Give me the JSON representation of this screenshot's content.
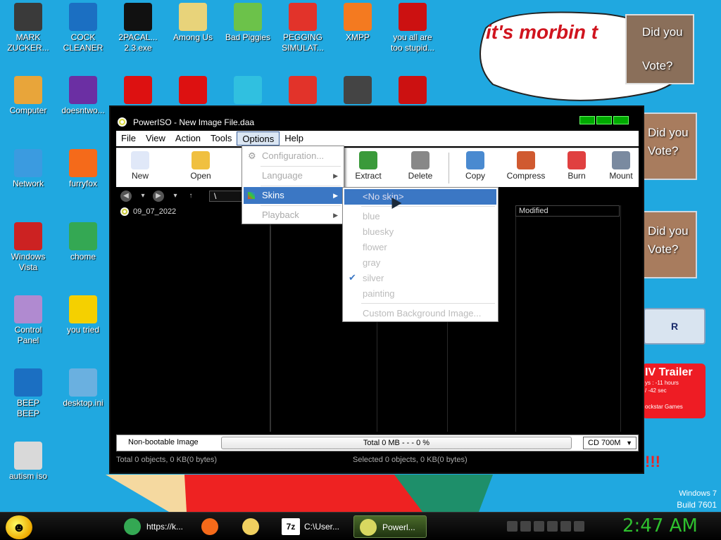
{
  "desktop": {
    "icons": [
      {
        "label": "MARK\nZUCKER...",
        "icon": "person-icon",
        "color": "#3a3a3a"
      },
      {
        "label": "COCK\nCLEANER",
        "icon": "book-icon",
        "color": "#1b6fc2"
      },
      {
        "label": "2PACAL...\n2.3.exe",
        "icon": "terminal-icon",
        "color": "#111111"
      },
      {
        "label": "Among Us",
        "icon": "drive-icon",
        "color": "#e8d37a"
      },
      {
        "label": "Bad Piggies",
        "icon": "pig-icon",
        "color": "#6cc24a"
      },
      {
        "label": "PEGGING\nSIMULAT...",
        "icon": "p-logo-icon",
        "color": "#e2332a"
      },
      {
        "label": "XMPP",
        "icon": "xampp-icon",
        "color": "#f47a20"
      },
      {
        "label": "you all are\ntoo stupid...",
        "icon": "dev-cpp-icon",
        "color": "#cc1111"
      },
      {
        "label": "Computer",
        "icon": "computer-icon",
        "color": "#e8a53a"
      },
      {
        "label": "doesntwo...",
        "icon": "yahoo-icon",
        "color": "#6b2fa3"
      },
      {
        "label": "",
        "icon": "angry-bird-icon",
        "color": "#d11"
      },
      {
        "label": "",
        "icon": "angry-bird-icon",
        "color": "#d11"
      },
      {
        "label": "",
        "icon": "gem-icon",
        "color": "#30c0e0"
      },
      {
        "label": "",
        "icon": "p-logo-icon",
        "color": "#e2332a"
      },
      {
        "label": "",
        "icon": "sd-icon",
        "color": "#444444"
      },
      {
        "label": "",
        "icon": "radiation-icon",
        "color": "#cc1111"
      },
      {
        "label": "Network",
        "icon": "globe-icon",
        "color": "#3b9be0"
      },
      {
        "label": "furryfox",
        "icon": "firefox-icon",
        "color": "#f56a1a"
      },
      {
        "label": "Windows\nVista",
        "icon": "recycle-bin-icon",
        "color": "#cc2222"
      },
      {
        "label": "chome",
        "icon": "chrome-icon",
        "color": "#34a853"
      },
      {
        "label": "Control\nPanel",
        "icon": "control-panel-icon",
        "color": "#b08ad0"
      },
      {
        "label": "you tried",
        "icon": "star-icon",
        "color": "#f5d000"
      },
      {
        "label": "BEEP\nBEEP",
        "icon": "book-icon",
        "color": "#1b6fc2"
      },
      {
        "label": "desktop.ini",
        "icon": "settings-file-icon",
        "color": "#6ab0e0"
      },
      {
        "label": "autism iso",
        "icon": "disc-icon",
        "color": "#d9d9d9"
      }
    ],
    "speech_text": "it's morbin t",
    "vote_cards": [
      {
        "text": "Did you\nVote?"
      },
      {
        "text": "Did you\nVote?"
      },
      {
        "text": "Did you\nVote?"
      }
    ],
    "president_text": "R PRESIDENT",
    "gta_title": "IV Trailer",
    "gta_line1": "ys : -11 hours",
    "gta_line2": "/ -42 sec",
    "gta_line3": "ockstar Games",
    "exclaim": "!!!",
    "windows_brand": "Windows 7",
    "build": "Build 7601"
  },
  "app": {
    "title": "PowerISO - New Image File.daa",
    "menu": [
      "File",
      "View",
      "Action",
      "Tools",
      "Options",
      "Help"
    ],
    "toolbar": [
      {
        "label": "New",
        "icon": "new-icon",
        "color": "#e0e8f8"
      },
      {
        "label": "Open",
        "icon": "open-folder-icon",
        "color": "#f0c040"
      },
      {
        "label": "Extract",
        "icon": "extract-icon",
        "color": "#3a9a3a"
      },
      {
        "label": "Delete",
        "icon": "delete-icon",
        "color": "#888888"
      },
      {
        "label": "Copy",
        "icon": "copy-icon",
        "color": "#4a8ad0"
      },
      {
        "label": "Compress",
        "icon": "compress-icon",
        "color": "#d05a30"
      },
      {
        "label": "Burn",
        "icon": "burn-icon",
        "color": "#e04040"
      },
      {
        "label": "Mount",
        "icon": "mount-icon",
        "color": "#7a8aa0"
      }
    ],
    "address": "\\",
    "tree_item": "09_07_2022",
    "list_header_modified": "Modified",
    "boot_status": "Non-bootable Image",
    "progress_text": "Total  0 MB   - - -  0 %",
    "progress_percent": 0,
    "capacity": "CD 700M",
    "status_total": "Total 0 objects, 0 KB(0 bytes)",
    "status_selected": "Selected 0 objects, 0 KB(0 bytes)"
  },
  "options_menu": {
    "items": [
      {
        "label": "Configuration...",
        "has_sub": false
      },
      {
        "label": "Language",
        "has_sub": true
      },
      {
        "label": "Skins",
        "has_sub": true
      },
      {
        "label": "Playback",
        "has_sub": true
      }
    ]
  },
  "skins_menu": {
    "items": [
      "<No skin>",
      "blue",
      "bluesky",
      "flower",
      "gray",
      "silver",
      "painting"
    ],
    "checked": "silver",
    "custom": "Custom Background Image..."
  },
  "taskbar": {
    "items": [
      {
        "label": "https://k...",
        "icon": "chrome-icon",
        "color": "#34a853"
      },
      {
        "label": "",
        "icon": "firefox-icon",
        "color": "#f56a1a"
      },
      {
        "label": "",
        "icon": "folder-icon",
        "color": "#f0d060"
      },
      {
        "label": "C:\\User...",
        "icon": "7zip-icon",
        "color": "#ffffff"
      },
      {
        "label": "Powerl...",
        "icon": "poweriso-icon",
        "color": "#d8d860"
      }
    ],
    "tray_icons": [
      "xampp-tray-icon",
      "search-tray-icon",
      "chat-tray-icon",
      "flag-tray-icon",
      "network-tray-icon",
      "volume-tray-icon"
    ],
    "clock": "2:47 AM"
  }
}
